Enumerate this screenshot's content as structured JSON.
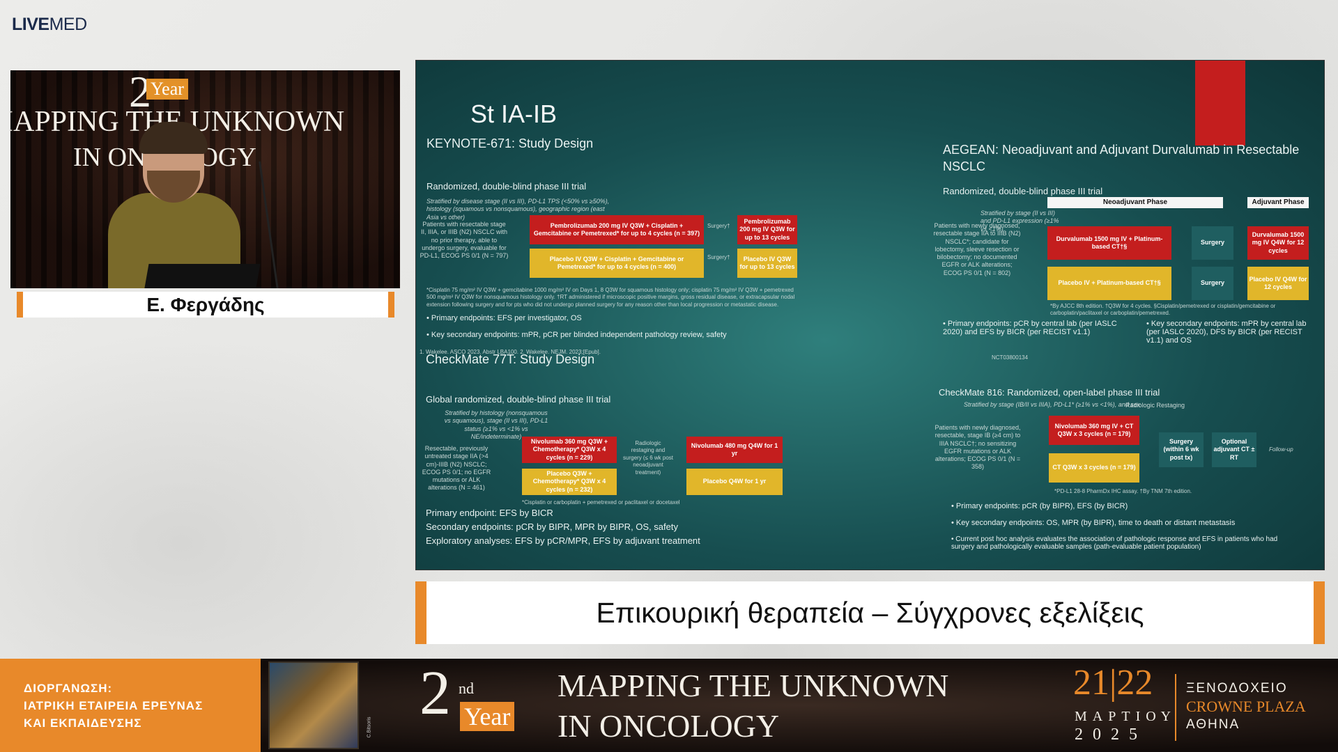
{
  "brand": {
    "logo_bold": "LIVE",
    "logo_light": "MED"
  },
  "camera": {
    "year_num": "2",
    "year_suffix": "nd",
    "year_word": "Year",
    "line1": "IAPPING THE UNKNOWN",
    "line2": "IN ONCOLOGY"
  },
  "speaker": {
    "name": "Ε. Φεργάδης"
  },
  "slide": {
    "title": "St IA-IB",
    "k671": {
      "title": "KEYNOTE-671: Study Design",
      "design": "Randomized, double-blind phase III trial",
      "strat": "Stratified by disease stage (II vs III), PD-L1 TPS (<50% vs ≥50%), histology (squamous vs nonsquamous), geographic region (east Asia vs other)",
      "patients": "Patients with resectable stage II, IIIA, or IIIB (N2) NSCLC with no prior therapy, able to undergo surgery, evaluable for PD-L1, ECOG PS 0/1 (N = 797)",
      "arm1": "Pembrolizumab 200 mg IV Q3W + Cisplatin + Gemcitabine or Pemetrexed* for up to 4 cycles (n = 397)",
      "arm1b": "Pembrolizumab 200 mg IV Q3W for up to 13 cycles",
      "arm2": "Placebo IV Q3W + Cisplatin + Gemcitabine or Pemetrexed* for up to 4 cycles (n = 400)",
      "arm2b": "Placebo IV Q3W for up to 13 cycles",
      "surgery": "Surgery†",
      "footnote": "*Cisplatin 75 mg/m² IV Q3W + gemcitabine 1000 mg/m² IV on Days 1, 8 Q3W for squamous histology only; cisplatin 75 mg/m² IV Q3W + pemetrexed 500 mg/m² IV Q3W for nonsquamous histology only. †RT administered if microscopic positive margins, gross residual disease, or extracapsular nodal extension following surgery and for pts who did not undergo planned surgery for any reason other than local progression or metastatic disease.",
      "ep1": "Primary endpoints: EFS per investigator, OS",
      "ep2": "Key secondary endpoints: mPR, pCR per blinded independent pathology review, safety",
      "ref": "1. Wakelee. ASCO 2023. Abstr LBA100. 2. Wakelee. NEJM. 2023;[Epub]."
    },
    "cm77t": {
      "title": "CheckMate 77T: Study Design",
      "design": "Global randomized, double-blind phase III trial",
      "strat": "Stratified by histology (nonsquamous vs squamous), stage (II vs III), PD-L1 status (≥1% vs <1% vs NE/indeterminate)",
      "patients": "Resectable, previously untreated stage IIA (>4 cm)-IIIB (N2) NSCLC; ECOG PS 0/1; no EGFR mutations or ALK alterations (N = 461)",
      "arm1": "Nivolumab 360 mg Q3W + Chemotherapy* Q3W x 4 cycles (n = 229)",
      "arm2": "Placebo Q3W + Chemotherapy* Q3W x 4 cycles (n = 232)",
      "mid": "Radiologic restaging and surgery (≤ 6 wk post neoadjuvant treatment)",
      "arm1b": "Nivolumab 480 mg Q4W for 1 yr",
      "arm2b": "Placebo Q4W for 1 yr",
      "note": "*Cisplatin or carboplatin + pemetrexed or paclitaxel or docetaxel",
      "ep1": "Primary endpoint: EFS by BICR",
      "ep2": "Secondary endpoints: pCR by BIPR, MPR by BIPR, OS, safety",
      "ep3": "Exploratory analyses: EFS by pCR/MPR, EFS by adjuvant treatment"
    },
    "aegean": {
      "title": "AEGEAN: Neoadjuvant and Adjuvant Durvalumab in Resectable NSCLC",
      "design": "Randomized, double-blind phase III trial",
      "neo": "Neoadjuvant Phase",
      "adj": "Adjuvant Phase",
      "strat": "Stratified by stage (II vs III) and PD-L1 expression (≥1% vs <1%)",
      "patients": "Patients with newly diagnosed, resectable stage IIA to IIIB (N2) NSCLC*; candidate for lobectomy, sleeve resection or bilobectomy; no documented EGFR or ALK alterations; ECOG PS 0/1 (N = 802)",
      "arm1": "Durvalumab 1500 mg IV + Platinum-based CT†§",
      "arm2": "Placebo IV + Platinum-based CT†§",
      "surgery": "Surgery",
      "arm1b": "Durvalumab 1500 mg IV Q4W for 12 cycles",
      "arm2b": "Placebo IV Q4W for 12 cycles",
      "footnote": "*By AJCC 8th edition. †Q3W for 4 cycles. §Cisplatin/pemetrexed or cisplatin/gemcitabine or carboplatin/paclitaxel or carboplatin/pemetrexed.",
      "ep1": "Primary endpoints: pCR by central lab (per IASLC 2020) and EFS by BICR (per RECIST v1.1)",
      "ep2": "Key secondary endpoints: mPR by central lab (per IASLC 2020), DFS by BICR (per RECIST v1.1) and OS",
      "nct": "NCT03800134"
    },
    "cm816": {
      "title": "CheckMate 816: Randomized, open-label phase III trial",
      "strat": "Stratified by stage (IB/II vs IIIA), PD-L1* (≥1% vs <1%), and sex",
      "restaging": "Radiologic Restaging",
      "patients": "Patients with newly diagnosed, resectable, stage IB (≥4 cm) to IIIA NSCLC†; no sensitizing EGFR mutations or ALK alterations; ECOG PS 0/1 (N = 358)",
      "arm1": "Nivolumab 360 mg IV + CT Q3W x 3 cycles (n = 179)",
      "arm2": "CT Q3W x 3 cycles (n = 179)",
      "surgery": "Surgery (within 6 wk post tx)",
      "adjuvant": "Optional adjuvant CT ± RT",
      "followup": "Follow-up",
      "footnote": "*PD-L1 28-8 PharmDx IHC assay. †By TNM 7th edition.",
      "ep1": "Primary endpoints: pCR (by BIPR), EFS (by BICR)",
      "ep2": "Key secondary endpoints: OS, MPR (by BIPR), time to death or distant metastasis",
      "ep3": "Current post hoc analysis evaluates the association of pathologic response and EFS in patients who had surgery and pathologically evaluable samples (path-evaluable patient population)"
    }
  },
  "caption": {
    "text": "Επικουρική θεραπεία – Σύγχρονες εξελίξεις"
  },
  "footer": {
    "org1": "ΔΙΟΡΓΑΝΩΣΗ:",
    "org2": "ΙΑΤΡΙΚΗ ΕΤΑΙΡΕΙΑ ΕΡΕΥΝΑΣ",
    "org3": "ΚΑΙ ΕΚΠΑΙΔΕΥΣΗΣ",
    "credit": "C.Bitsoris",
    "year_num": "2",
    "year_suffix": "nd",
    "year_word": "Year",
    "line1": "MAPPING THE UNKNOWN",
    "line2": "IN ONCOLOGY",
    "dates": "21|22",
    "month": "ΜΑΡΤΙΟΥ",
    "year": "2025",
    "hotel1": "ΞΕΝΟΔΟΧΕΙΟ",
    "hotel2": "CROWNE PLAZA",
    "hotel3": "ΑΘΗΝΑ"
  },
  "colors": {
    "accent": "#e8892a",
    "slide_bg": "#1f6463",
    "arm_red": "#c41e1e",
    "arm_yellow": "#e1b62a"
  }
}
